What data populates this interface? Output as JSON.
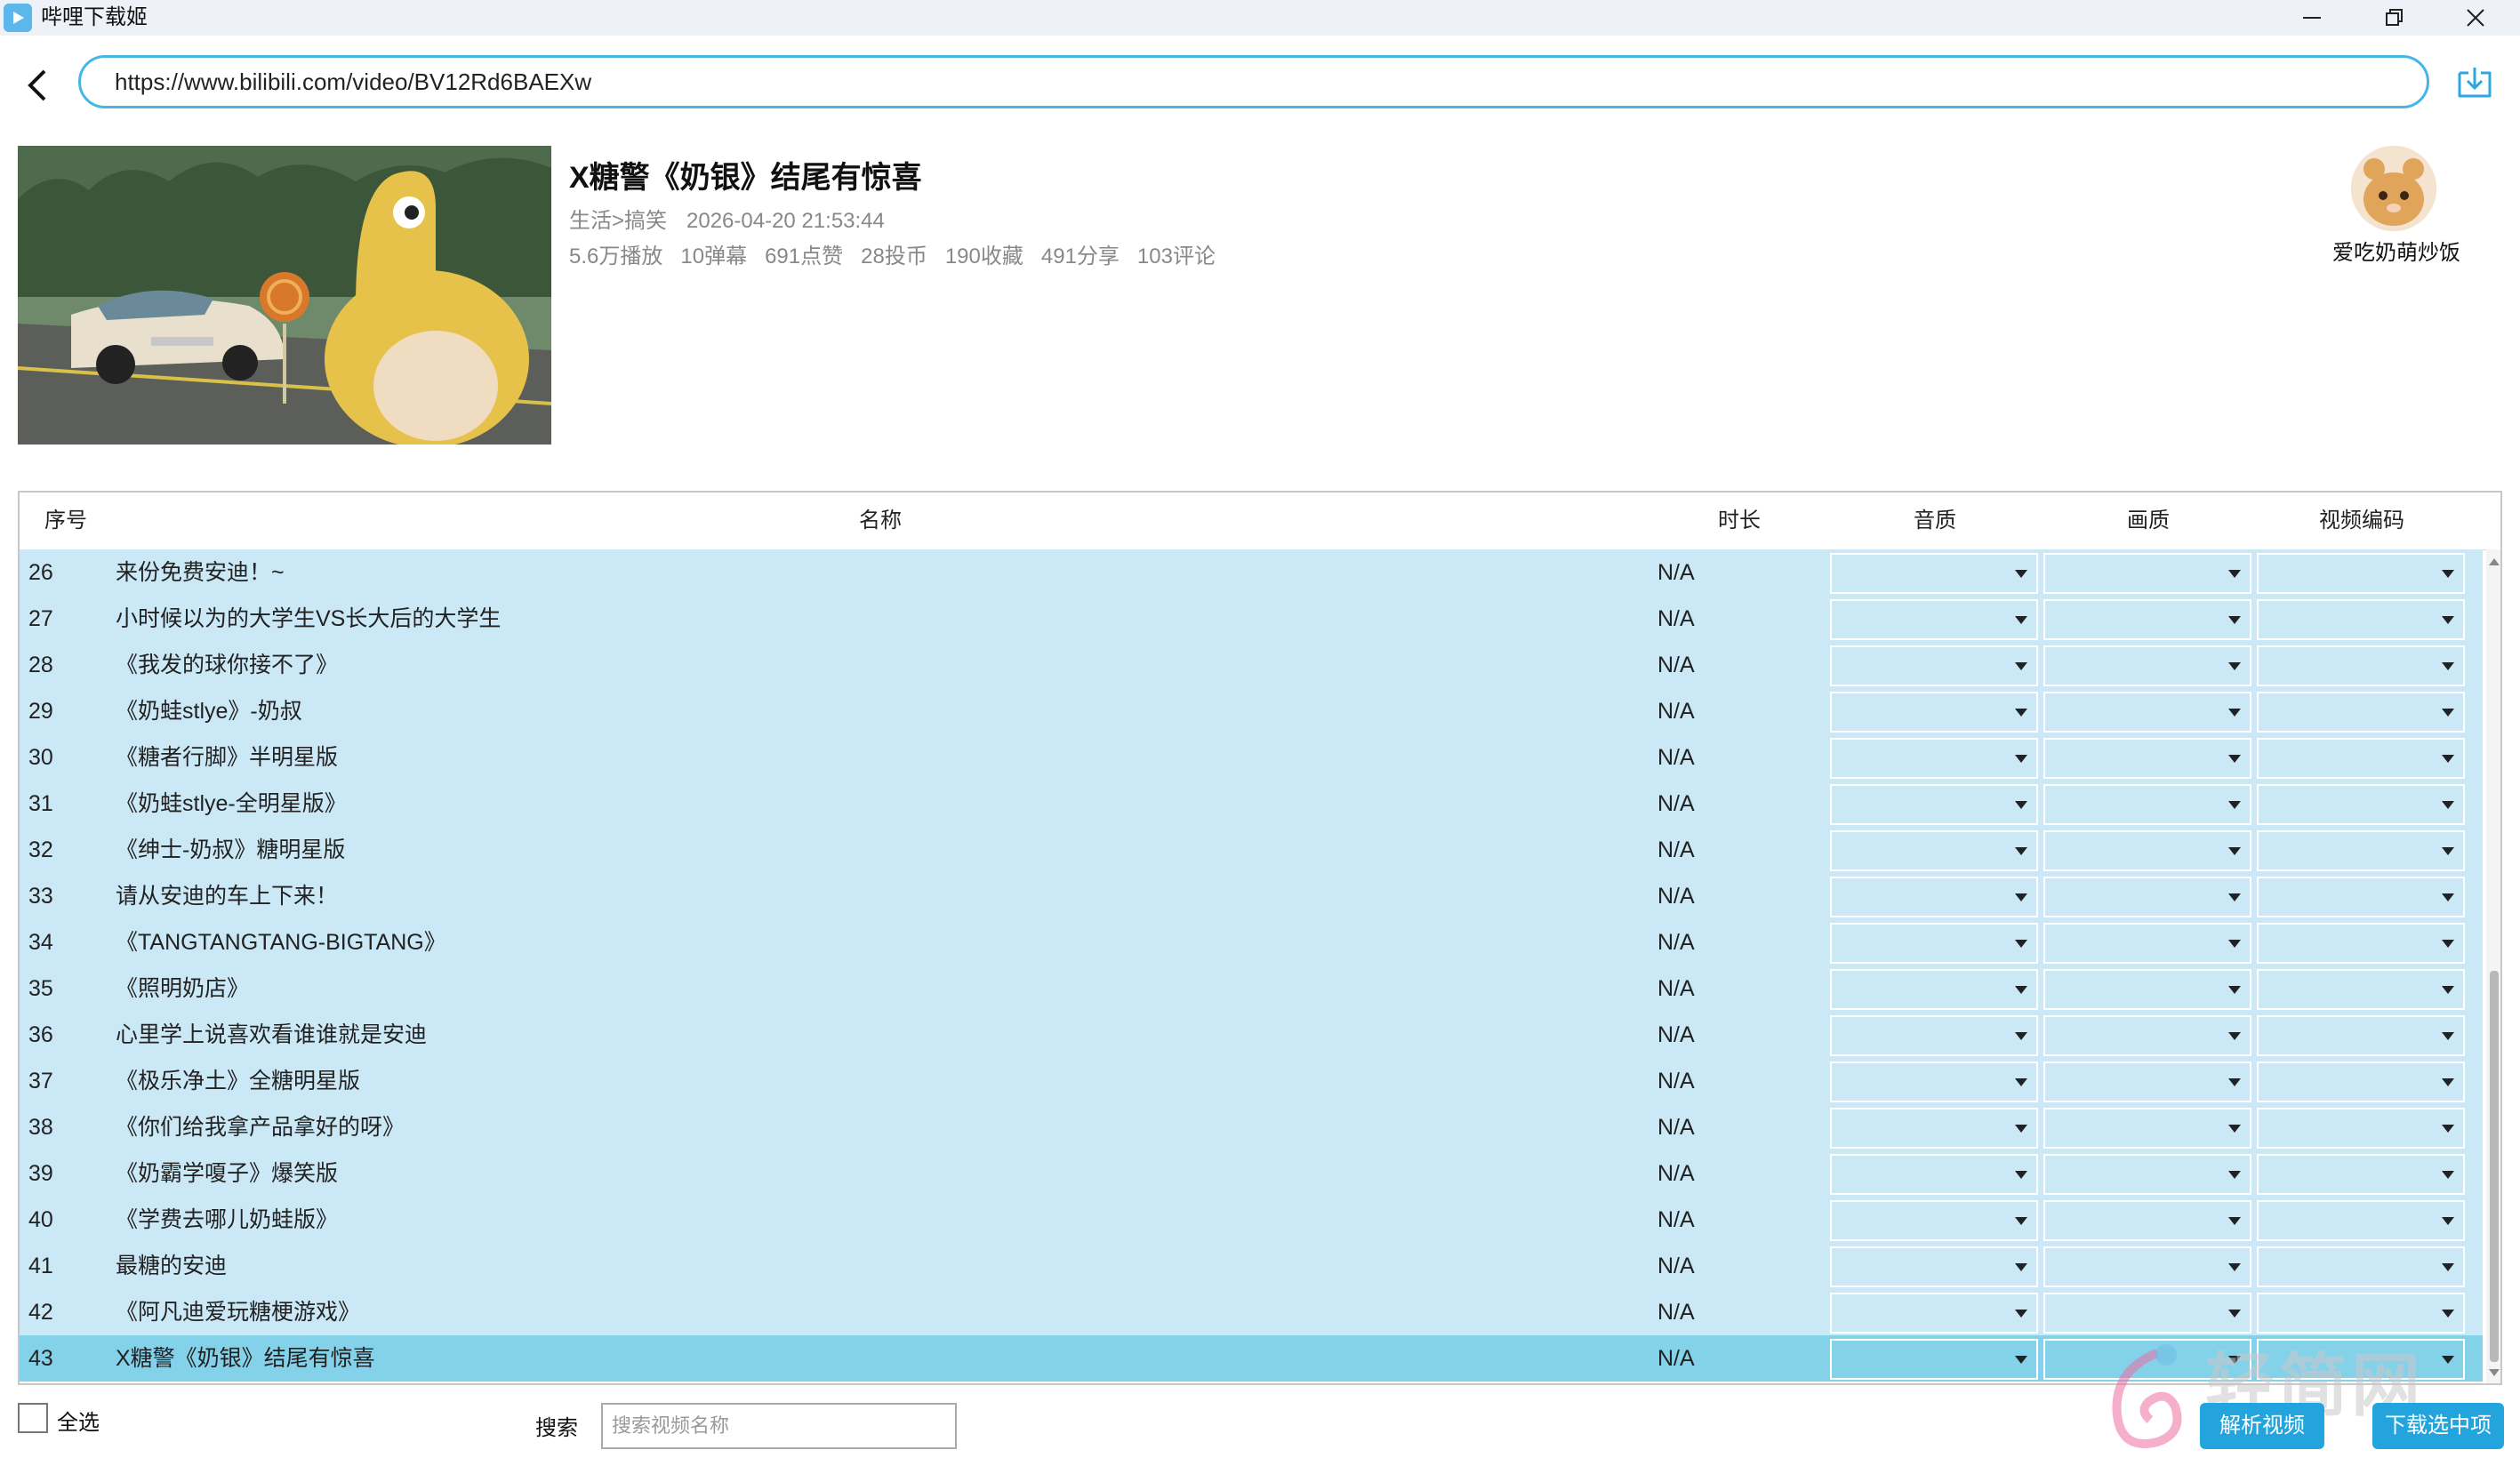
{
  "window": {
    "title": "哔哩下载姬",
    "accent": "#45b6e6"
  },
  "url_bar": {
    "value": "https://www.bilibili.com/video/BV12Rd6BAEXw"
  },
  "video": {
    "title": "X糖警《奶银》结尾有惊喜",
    "category": "生活>搞笑",
    "datetime": "2026-04-20 21:53:44",
    "stats": [
      "5.6万播放",
      "10弹幕",
      "691点赞",
      "28投币",
      "190收藏",
      "491分享",
      "103评论"
    ],
    "uploader": "爱吃奶萌炒饭"
  },
  "table": {
    "headers": {
      "index": "序号",
      "name": "名称",
      "duration": "时长",
      "audio_quality": "音质",
      "video_quality": "画质",
      "video_codec": "视频编码"
    },
    "rows": [
      {
        "index": "26",
        "name": "来份免费安迪！~",
        "duration": "N/A"
      },
      {
        "index": "27",
        "name": "小时候以为的大学生VS长大后的大学生",
        "duration": "N/A"
      },
      {
        "index": "28",
        "name": "《我发的球你接不了》",
        "duration": "N/A"
      },
      {
        "index": "29",
        "name": "《奶蛙stlye》-奶叔",
        "duration": "N/A"
      },
      {
        "index": "30",
        "name": "《糖者行脚》半明星版",
        "duration": "N/A"
      },
      {
        "index": "31",
        "name": "《奶蛙stlye-全明星版》",
        "duration": "N/A"
      },
      {
        "index": "32",
        "name": "《绅士-奶叔》糖明星版",
        "duration": "N/A"
      },
      {
        "index": "33",
        "name": "请从安迪的车上下来！",
        "duration": "N/A"
      },
      {
        "index": "34",
        "name": "《TANGTANGTANG-BIGTANG》",
        "duration": "N/A"
      },
      {
        "index": "35",
        "name": "《照明奶店》",
        "duration": "N/A"
      },
      {
        "index": "36",
        "name": "心里学上说喜欢看谁谁就是安迪",
        "duration": "N/A"
      },
      {
        "index": "37",
        "name": "《极乐净土》全糖明星版",
        "duration": "N/A"
      },
      {
        "index": "38",
        "name": "《你们给我拿产品拿好的呀》",
        "duration": "N/A"
      },
      {
        "index": "39",
        "name": "《奶霸学嗄子》爆笑版",
        "duration": "N/A"
      },
      {
        "index": "40",
        "name": "《学费去哪儿奶蛙版》",
        "duration": "N/A"
      },
      {
        "index": "41",
        "name": "最糖的安迪",
        "duration": "N/A"
      },
      {
        "index": "42",
        "name": "《阿凡迪爱玩糖梗游戏》",
        "duration": "N/A"
      },
      {
        "index": "43",
        "name": "X糖警《奶银》结尾有惊喜",
        "duration": "N/A",
        "selected": true
      }
    ],
    "row_color": "#cbe8f6",
    "selected_row_color": "#84d1ea"
  },
  "footer": {
    "select_all_label": "全选",
    "search_label": "搜索",
    "search_placeholder": "搜索视频名称",
    "parse_button": "解析视频",
    "download_button": "下载选中项",
    "button_color": "#23a4dc"
  },
  "watermark": {
    "text": "轻简网"
  },
  "icons": {
    "app": "bilibili-download-icon",
    "back": "back-arrow-icon",
    "download": "download-icon",
    "minimize": "minimize-icon",
    "maximize": "maximize-icon",
    "close": "close-icon"
  }
}
